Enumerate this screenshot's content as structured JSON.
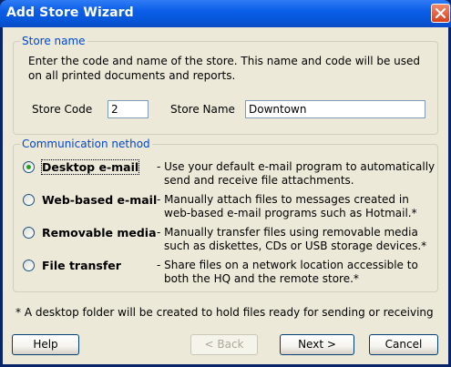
{
  "window": {
    "title": "Add Store Wizard"
  },
  "store_name_group": {
    "legend": "Store name",
    "description_line1": "Enter the code and name of the store. This name and code will be used",
    "description_line2": "on all printed documents and reports.",
    "store_code_label": "Store Code",
    "store_code_value": "2",
    "store_name_label": "Store Name",
    "store_name_value": "Downtown"
  },
  "comm_group": {
    "legend": "Communication nethod",
    "options": [
      {
        "label": "Desktop e-mail",
        "selected": true,
        "desc_line1": "- Use your default e-mail program to automatically",
        "desc_line2": "send and receive file attachments."
      },
      {
        "label": "Web-based e-mail",
        "selected": false,
        "desc_line1": "- Manually attach files to messages created in",
        "desc_line2": "web-based e-mail programs such as Hotmail.*"
      },
      {
        "label": "Removable media",
        "selected": false,
        "desc_line1": "- Manually transfer files using removable media",
        "desc_line2": "such as diskettes, CDs or USB storage devices.*"
      },
      {
        "label": "File transfer",
        "selected": false,
        "desc_line1": "- Share files on a network location accessible to",
        "desc_line2": "both the HQ and the remote store.*"
      }
    ]
  },
  "footnote": "* A desktop folder will be created to hold files ready for sending or receiving",
  "buttons": {
    "help": "Help",
    "back": "< Back",
    "next": "Next >",
    "cancel": "Cancel"
  },
  "colors": {
    "accent": "#0046d5",
    "titlebar": "#0b5ee8",
    "dialog_bg": "#ece9d8"
  },
  "icons": {
    "close": "close-icon"
  }
}
